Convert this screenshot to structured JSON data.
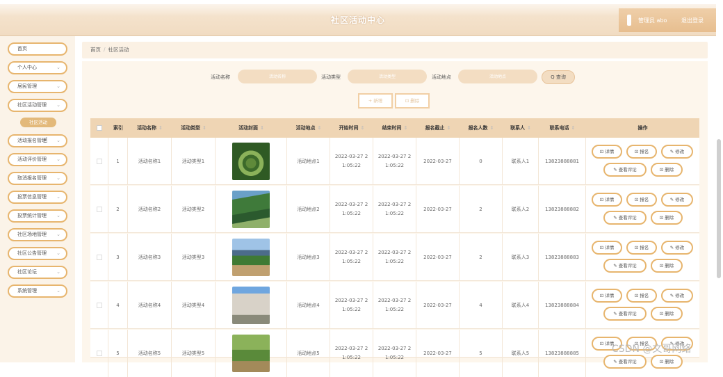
{
  "header": {
    "title": "社区活动中心",
    "user": "管理员 abo",
    "logout": "退出登录"
  },
  "sidebar": {
    "items": [
      {
        "label": "首页",
        "chevron": false
      },
      {
        "label": "个人中心",
        "chevron": true
      },
      {
        "label": "居民管理",
        "chevron": true
      },
      {
        "label": "社区活动管理",
        "chevron": true
      },
      {
        "label": "活动报名管理",
        "chevron": true
      },
      {
        "label": "活动评价管理",
        "chevron": true
      },
      {
        "label": "取消报名管理",
        "chevron": true
      },
      {
        "label": "投票信息管理",
        "chevron": true
      },
      {
        "label": "投票统计管理",
        "chevron": true
      },
      {
        "label": "社区场地管理",
        "chevron": true
      },
      {
        "label": "社区公告管理",
        "chevron": true
      },
      {
        "label": "社区论坛",
        "chevron": true
      },
      {
        "label": "系统管理",
        "chevron": true
      }
    ],
    "active_sub": "社区活动"
  },
  "breadcrumb": {
    "home": "首页",
    "current": "社区活动"
  },
  "search": {
    "name_label": "活动名称",
    "name_placeholder": "活动名称",
    "type_label": "活动类型",
    "type_placeholder": "活动类型",
    "place_label": "活动地点",
    "place_placeholder": "活动地点",
    "query_label": "Q 查询"
  },
  "actions": {
    "add": "+ 新增",
    "delete": "⊡ 删除"
  },
  "table": {
    "headers": [
      "索引",
      "活动名称",
      "活动类型",
      "活动封面",
      "活动地点",
      "开始时间",
      "结束时间",
      "报名截止",
      "报名人数",
      "联系人",
      "联系电话",
      "操作"
    ],
    "rows": [
      {
        "index": "1",
        "name": "活动名称1",
        "type": "活动类型1",
        "place": "活动地点1",
        "start": "2022-03-27 21:05:22",
        "end": "2022-03-27 21:05:22",
        "deadline": "2022-03-27",
        "count": "0",
        "contact": "联系人1",
        "phone": "13823888881"
      },
      {
        "index": "2",
        "name": "活动名称2",
        "type": "活动类型2",
        "place": "活动地点2",
        "start": "2022-03-27 21:05:22",
        "end": "2022-03-27 21:05:22",
        "deadline": "2022-03-27",
        "count": "2",
        "contact": "联系人2",
        "phone": "13823888882"
      },
      {
        "index": "3",
        "name": "活动名称3",
        "type": "活动类型3",
        "place": "活动地点3",
        "start": "2022-03-27 21:05:22",
        "end": "2022-03-27 21:05:22",
        "deadline": "2022-03-27",
        "count": "2",
        "contact": "联系人3",
        "phone": "13823888883"
      },
      {
        "index": "4",
        "name": "活动名称4",
        "type": "活动类型4",
        "place": "活动地点4",
        "start": "2022-03-27 21:05:22",
        "end": "2022-03-27 21:05:22",
        "deadline": "2022-03-27",
        "count": "4",
        "contact": "联系人4",
        "phone": "13823888884"
      },
      {
        "index": "5",
        "name": "活动名称5",
        "type": "活动类型5",
        "place": "活动地点5",
        "start": "2022-03-27 21:05:22",
        "end": "2022-03-27 21:05:22",
        "deadline": "2022-03-27",
        "count": "5",
        "contact": "联系人5",
        "phone": "13823888885"
      }
    ],
    "ops": {
      "detail": "⊡ 详情",
      "signup": "⊡ 报名",
      "edit": "✎ 修改",
      "review": "✎ 查看评论",
      "remove": "⊡ 删除"
    }
  },
  "watermark": "CSDN @文哥网络",
  "colors": {
    "accent": "#e7b56e",
    "header_bg": "#f1dcc2",
    "table_head": "#efd5b4"
  }
}
